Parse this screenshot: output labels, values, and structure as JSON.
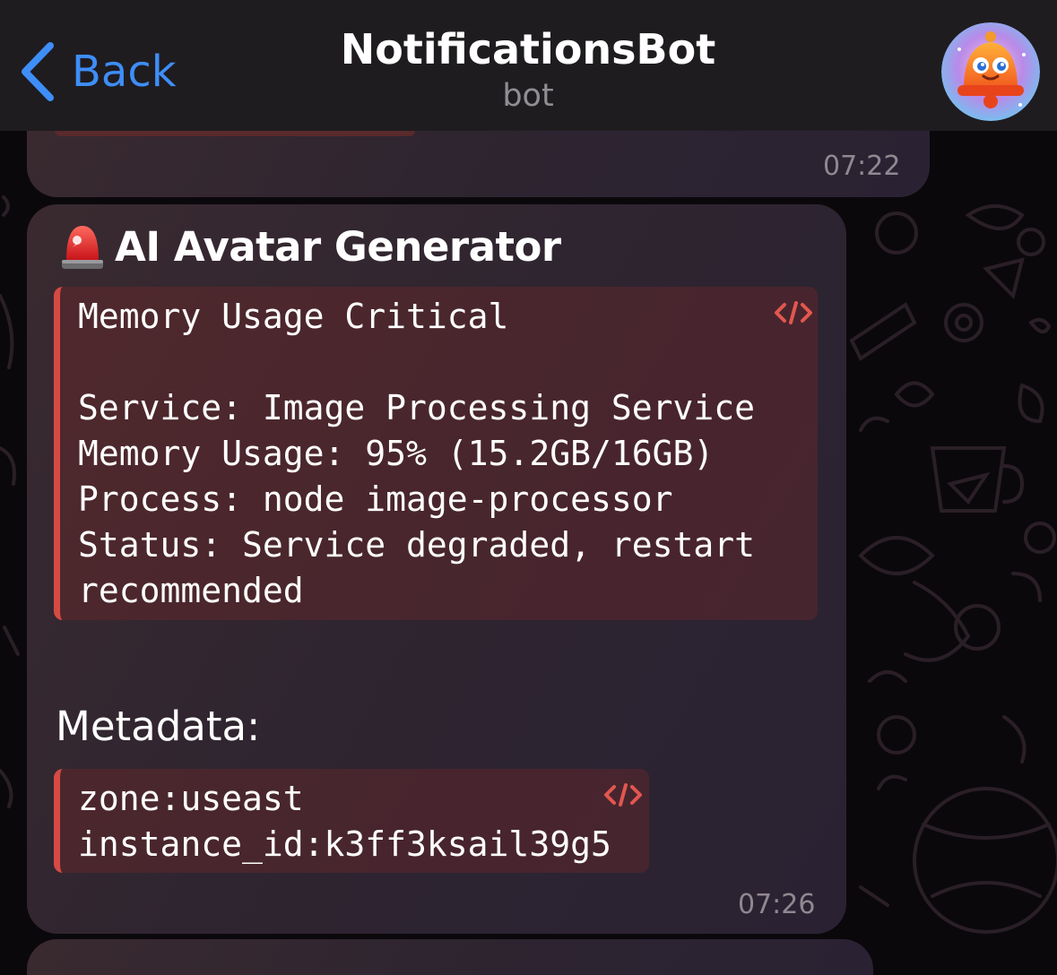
{
  "header": {
    "back_label": "Back",
    "title": "NotificationsBot",
    "subtitle": "bot"
  },
  "messages": [
    {
      "time": "07:22"
    },
    {
      "title": "AI Avatar Generator",
      "code_block_main": "Memory Usage Critical\n\nService: Image Processing Service\nMemory Usage: 95% (15.2GB/16GB)\nProcess: node image-processor\nStatus: Service degraded, restart\nrecommended",
      "metadata_label": "Metadata:",
      "code_block_meta": "zone:useast\ninstance_id:k3ff3ksail39g5",
      "time": "07:26"
    }
  ],
  "icons": {
    "back": "chevron-left-icon",
    "avatar": "bell-avatar",
    "alert": "siren-icon",
    "code": "code-icon"
  },
  "colors": {
    "accent": "#3e8ef7",
    "code_border": "#d64a44",
    "header_bg": "#1f1c20"
  }
}
